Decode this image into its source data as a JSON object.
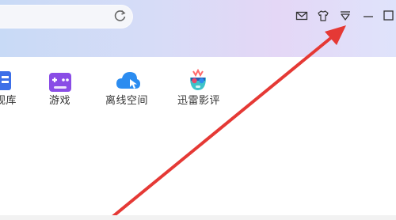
{
  "tiles": [
    {
      "label": "视库",
      "icon": "video-library-icon",
      "color": "#3d6fe8"
    },
    {
      "label": "游戏",
      "icon": "game-icon",
      "color": "#8a4de6"
    },
    {
      "label": "离线空间",
      "icon": "cloud-icon",
      "color": "#2b8cf0"
    },
    {
      "label": "迅雷影评",
      "icon": "movie-review-icon",
      "color": "#3fc3c9"
    }
  ],
  "window_controls": [
    "mail-icon",
    "shirt-skin-icon",
    "menu-dropdown-icon",
    "minimize-icon",
    "maximize-icon"
  ],
  "annotation": {
    "arrow_color": "#e53935"
  }
}
